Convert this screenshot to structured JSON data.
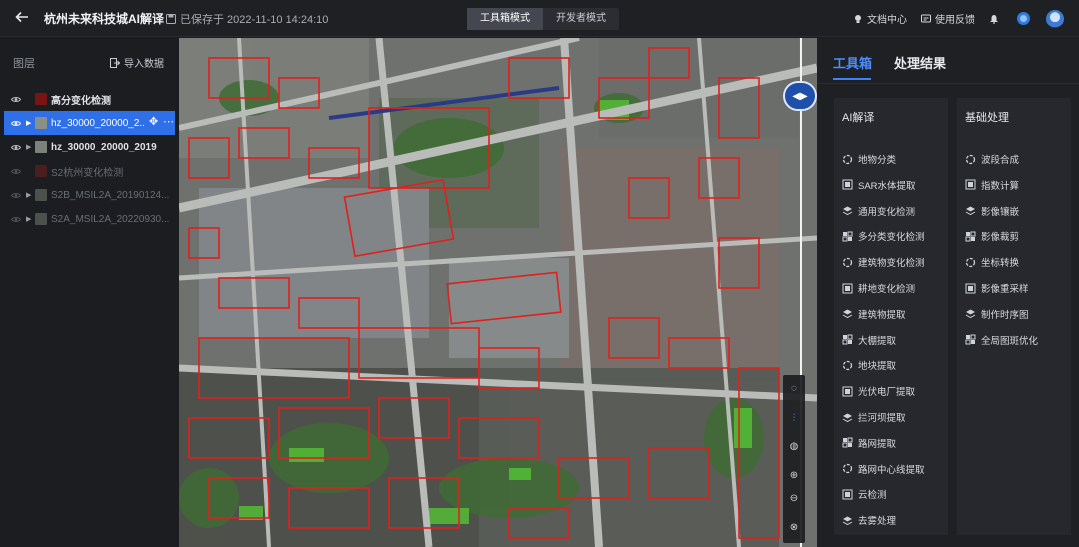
{
  "header": {
    "back_icon": "arrow-left-icon",
    "title": "杭州未来科技城AI解译",
    "saved_text": "已保存于 2022-11-10 14:24:10",
    "modes": [
      {
        "label": "工具箱模式",
        "active": true
      },
      {
        "label": "开发者模式",
        "active": false
      }
    ],
    "docs_label": "文档中心",
    "feedback_label": "使用反馈"
  },
  "left_panel": {
    "title": "图层",
    "import_label": "导入数据",
    "layers": [
      {
        "name": "高分变化检测"
      },
      {
        "name": "hz_30000_20000_2..."
      },
      {
        "name": "hz_30000_20000_2019"
      },
      {
        "name": "S2杭州变化检测"
      },
      {
        "name": "S2B_MSIL2A_20190124..."
      },
      {
        "name": "S2A_MSIL2A_20220930..."
      }
    ]
  },
  "right_panel": {
    "tabs": [
      {
        "label": "工具箱",
        "active": true
      },
      {
        "label": "处理结果",
        "active": false
      }
    ],
    "ai_section": {
      "title": "AI解译",
      "tools": [
        "地物分类",
        "SAR水体提取",
        "通用变化检测",
        "多分类变化检测",
        "建筑物变化检测",
        "耕地变化检测",
        "建筑物提取",
        "大棚提取",
        "地块提取",
        "光伏电厂提取",
        "拦河坝提取",
        "路网提取",
        "路网中心线提取",
        "云检测",
        "去雾处理"
      ]
    },
    "basic_section": {
      "title": "基础处理",
      "tools": [
        "波段合成",
        "指数计算",
        "影像镶嵌",
        "影像裁剪",
        "坐标转换",
        "影像重采样",
        "制作时序图",
        "全局图斑优化"
      ]
    },
    "accent_color": "#3a83ff"
  }
}
